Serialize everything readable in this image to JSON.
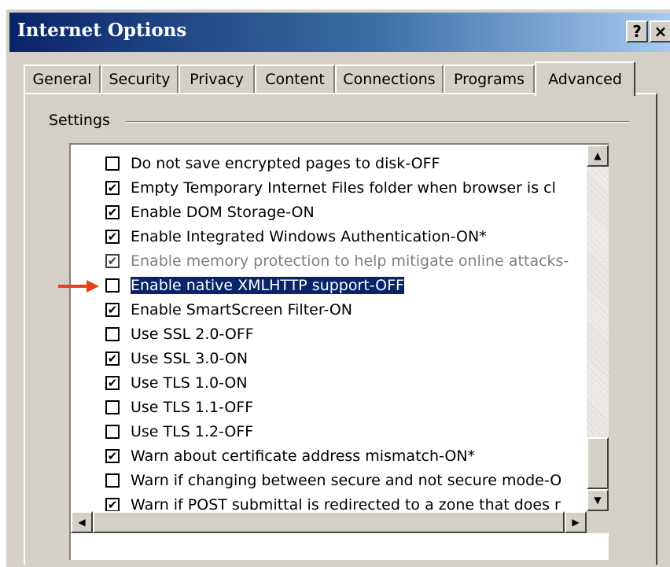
{
  "window": {
    "title": "Internet Options",
    "help_label": "?",
    "close_label": "×"
  },
  "tabs": [
    {
      "label": "General"
    },
    {
      "label": "Security"
    },
    {
      "label": "Privacy"
    },
    {
      "label": "Content"
    },
    {
      "label": "Connections"
    },
    {
      "label": "Programs"
    },
    {
      "label": "Advanced",
      "active": true
    }
  ],
  "settings": {
    "group_label": "Settings",
    "items": [
      {
        "label": "Do not save encrypted pages to disk-OFF",
        "checked": false
      },
      {
        "label": "Empty Temporary Internet Files folder when browser is cl",
        "checked": true
      },
      {
        "label": "Enable DOM Storage-ON",
        "checked": true
      },
      {
        "label": "Enable Integrated Windows Authentication-ON*",
        "checked": true
      },
      {
        "label": "Enable memory protection to help mitigate online attacks-",
        "checked": true,
        "disabled": true
      },
      {
        "label": "Enable native XMLHTTP support-OFF",
        "checked": false,
        "selected": true
      },
      {
        "label": "Enable SmartScreen Filter-ON",
        "checked": true
      },
      {
        "label": "Use SSL 2.0-OFF",
        "checked": false
      },
      {
        "label": "Use SSL 3.0-ON",
        "checked": true
      },
      {
        "label": "Use TLS 1.0-ON",
        "checked": true
      },
      {
        "label": "Use TLS 1.1-OFF",
        "checked": false
      },
      {
        "label": "Use TLS 1.2-OFF",
        "checked": false
      },
      {
        "label": "Warn about certificate address mismatch-ON*",
        "checked": true
      },
      {
        "label": "Warn if changing between secure and not secure mode-O",
        "checked": false
      },
      {
        "label": "Warn if POST submittal is redirected to a zone that does r",
        "checked": true
      }
    ]
  },
  "scrollbar_glyphs": {
    "up": "▲",
    "down": "▼",
    "left": "◀",
    "right": "▶"
  },
  "colors": {
    "titlebar_start": "#0a246a",
    "selection": "#0a246a",
    "pointer_arrow": "#e8401c",
    "face": "#d4d0c8"
  },
  "icons": {
    "help": "question-icon",
    "close": "close-icon",
    "checkbox": "checkmark-icon",
    "annotation": "red-arrow-icon"
  }
}
